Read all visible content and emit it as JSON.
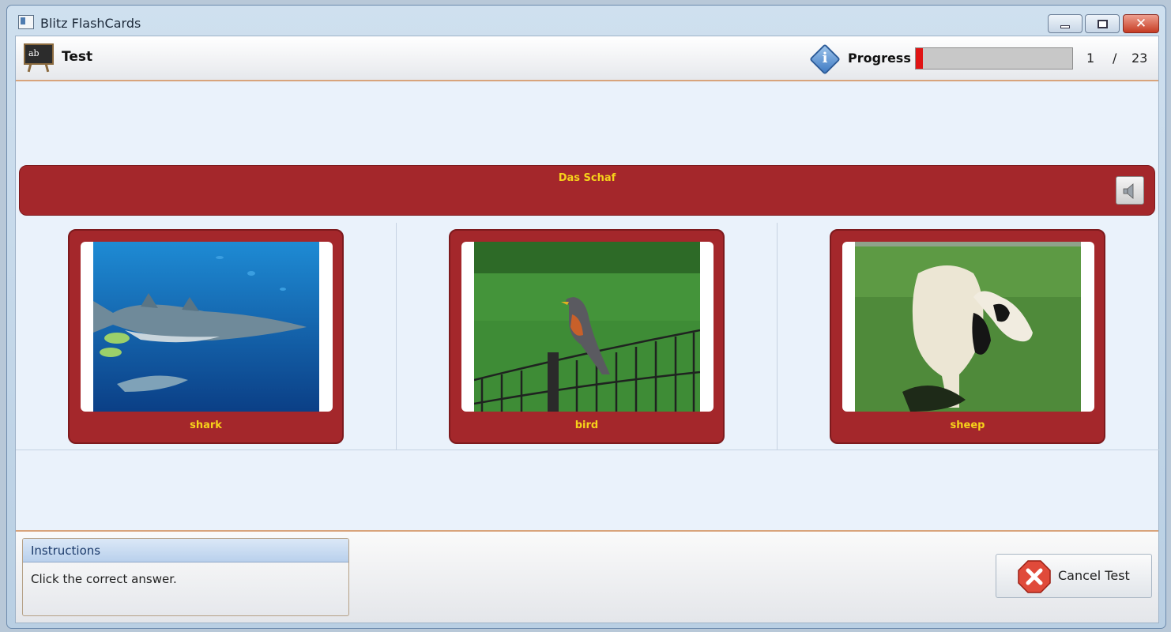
{
  "window": {
    "title": "Blitz FlashCards"
  },
  "header": {
    "title": "Test",
    "progress_label": "Progress",
    "progress_fraction": 0.043,
    "progress_current": "1",
    "progress_separator": "/",
    "progress_total": "23"
  },
  "question": {
    "text": "Das Schaf"
  },
  "answers": [
    {
      "label": "shark"
    },
    {
      "label": "bird"
    },
    {
      "label": "sheep"
    }
  ],
  "instructions": {
    "title": "Instructions",
    "text": "Click the correct answer."
  },
  "footer": {
    "cancel_label": "Cancel Test"
  },
  "icons": {
    "app": "app-icon",
    "test": "blackboard-icon",
    "info": "info-icon",
    "speaker": "speaker-icon",
    "cancel": "cancel-x-icon"
  },
  "colors": {
    "card_red": "#a4272b",
    "label_yellow": "#f6d21a",
    "progress_red": "#e01414"
  }
}
